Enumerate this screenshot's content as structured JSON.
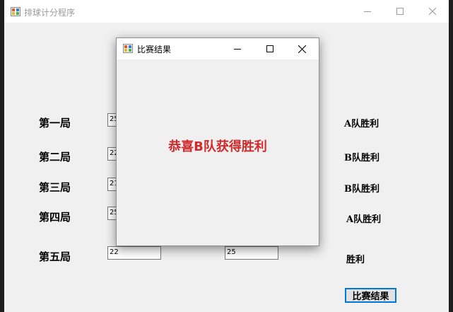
{
  "main_window": {
    "title": "排球计分程序"
  },
  "games": [
    {
      "label": "第一局",
      "team_a_score": "25",
      "team_b_score": "",
      "result": "A队胜利"
    },
    {
      "label": "第二局",
      "team_a_score": "22",
      "team_b_score": "",
      "result": "B队胜利"
    },
    {
      "label": "第三局",
      "team_a_score": "21",
      "team_b_score": "",
      "result": "B队胜利"
    },
    {
      "label": "第四局",
      "team_a_score": "25",
      "team_b_score": "",
      "result": "A队胜利"
    },
    {
      "label": "第五局",
      "team_a_score": "22",
      "team_b_score": "25",
      "result": "胜利"
    }
  ],
  "result_button_label": "比赛结果",
  "dialog": {
    "title": "比赛结果",
    "message": "恭喜B队获得胜利",
    "message_color": "#d22a2a"
  }
}
